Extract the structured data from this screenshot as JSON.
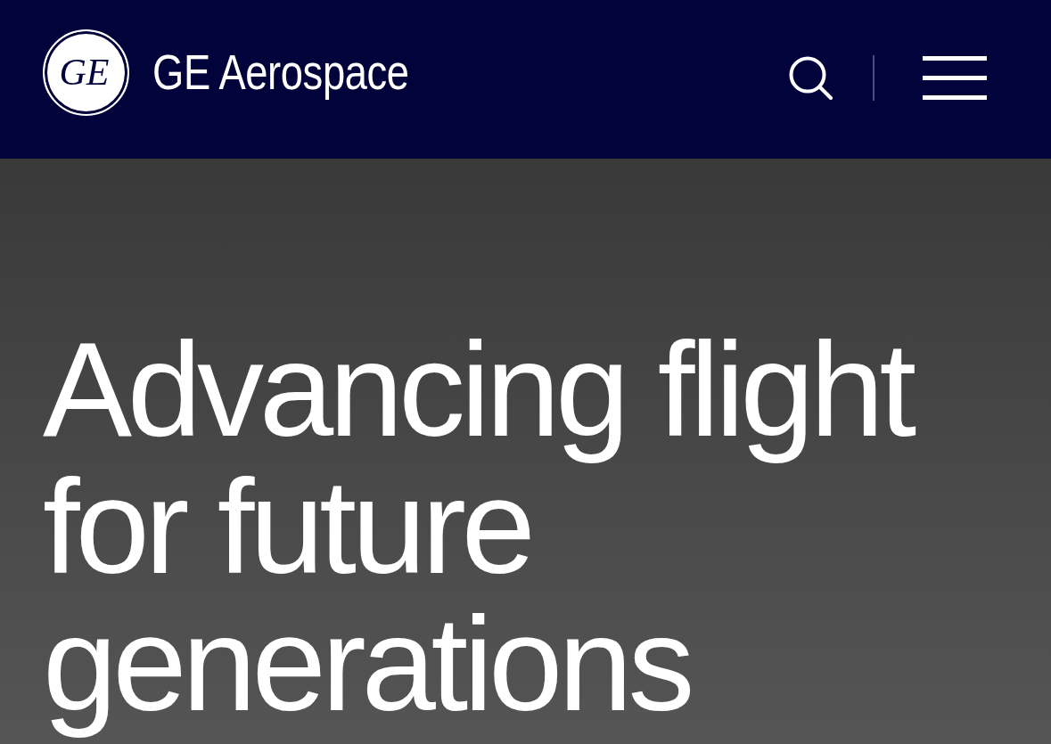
{
  "header": {
    "logo": {
      "monogram": "GE",
      "brand": "GE Aerospace"
    },
    "actions": [
      {
        "kind": "search"
      },
      {
        "kind": "menu"
      }
    ]
  },
  "hero": {
    "headline_lines": [
      "Advancing flight",
      "for future",
      "generations"
    ]
  }
}
